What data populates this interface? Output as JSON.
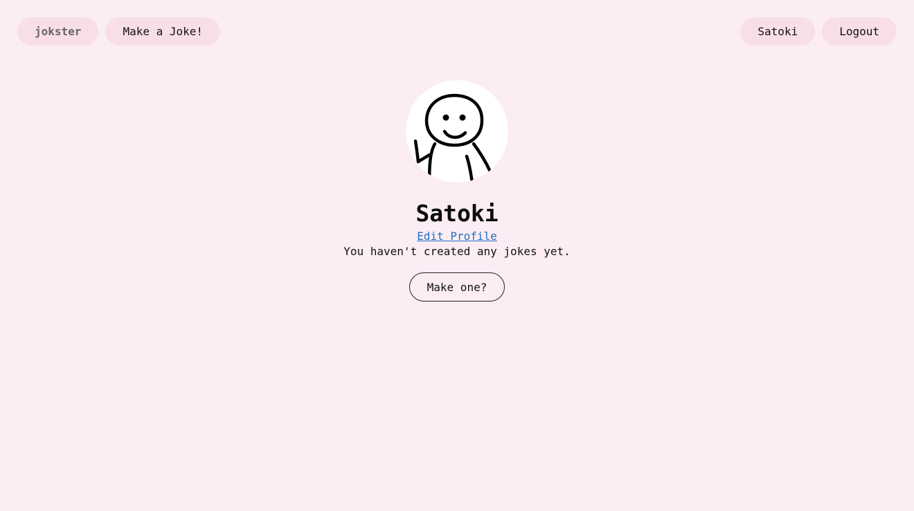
{
  "nav": {
    "brand_label": "jokster",
    "make_joke_label": "Make a Joke!",
    "user_label": "Satoki",
    "logout_label": "Logout"
  },
  "profile": {
    "avatar_icon": "stick-figure-avatar-icon",
    "username": "Satoki",
    "edit_profile_label": "Edit Profile",
    "empty_message": "You haven't created any jokes yet.",
    "make_one_label": "Make one?"
  },
  "colors": {
    "background": "#fbedf3",
    "pill": "#f8dfe6",
    "link": "#1e6fc4"
  }
}
